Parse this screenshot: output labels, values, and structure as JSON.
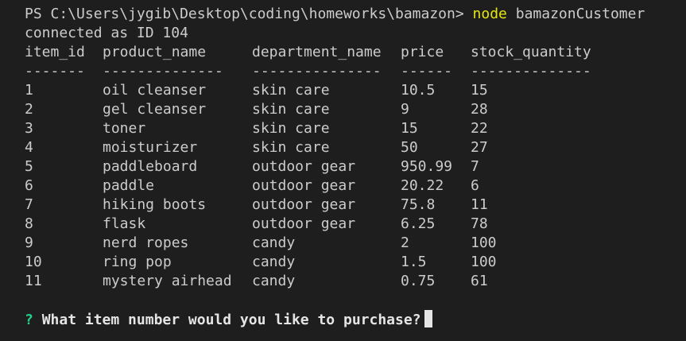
{
  "prompt": {
    "path": "PS C:\\Users\\jygib\\Desktop\\coding\\homeworks\\bamazon>",
    "command": "node",
    "args": "bamazonCustomer"
  },
  "status_line": "connected as ID 104",
  "table": {
    "headers": [
      "item_id",
      "product_name",
      "department_name",
      "price",
      "stock_quantity"
    ],
    "separators": [
      "-------",
      "--------------",
      "---------------",
      "------",
      "--------------"
    ],
    "rows": [
      [
        "1",
        "oil cleanser",
        "skin care",
        "10.5",
        "15"
      ],
      [
        "2",
        "gel cleanser",
        "skin care",
        "9",
        "28"
      ],
      [
        "3",
        "toner",
        "skin care",
        "15",
        "22"
      ],
      [
        "4",
        "moisturizer",
        "skin care",
        "50",
        "27"
      ],
      [
        "5",
        "paddleboard",
        "outdoor gear",
        "950.99",
        "7"
      ],
      [
        "6",
        "paddle",
        "outdoor gear",
        "20.22",
        "6"
      ],
      [
        "7",
        "hiking boots",
        "outdoor gear",
        "75.8",
        "11"
      ],
      [
        "8",
        "flask",
        "outdoor gear",
        "6.25",
        "78"
      ],
      [
        "9",
        "nerd ropes",
        "candy",
        "2",
        "100"
      ],
      [
        "10",
        "ring pop",
        "candy",
        "1.5",
        "100"
      ],
      [
        "11",
        "mystery airhead",
        "candy",
        "0.75",
        "61"
      ]
    ]
  },
  "question": {
    "mark": "?",
    "text": "What item number would you like to purchase?"
  },
  "colors": {
    "background": "#1e1e1e",
    "text": "#cccccc",
    "command": "#e5e510",
    "question_mark": "#23d18b"
  }
}
